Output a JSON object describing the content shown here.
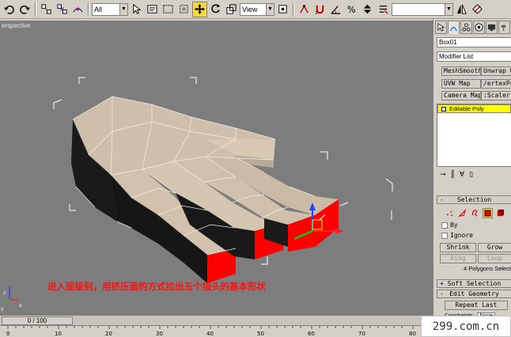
{
  "toolbar": {
    "filter_select": "All",
    "refcoord_select": "View",
    "named_sel_select": ""
  },
  "viewport": {
    "label": "erspective",
    "caption": "进入面级别，用挤压面的方式拉出五个指头的基本形状"
  },
  "timebar": {
    "slider": "0 / 100"
  },
  "ruler": {
    "ticks": [
      "0",
      "10",
      "20",
      "30",
      "40",
      "50",
      "60",
      "70",
      "80"
    ]
  },
  "panel": {
    "object_name": "Box01",
    "modifier_list": "Modifier List",
    "mod_buttons": [
      "MeshSmooth",
      "Unwrap UV",
      "UVW Map",
      "/ertexPai",
      "Camera Map",
      ":Scaler ("
    ],
    "stack_item": "Editable Poly",
    "selection": {
      "header": "Selection",
      "by": "By",
      "ignore": "Ignore",
      "shrink": "Shrink",
      "grow": "Grow",
      "ring": "Ring",
      "loop": "Loop",
      "status": "4 Polygons Selecte"
    },
    "soft_selection": "Soft Selection",
    "edit_geometry": "Edit Geometry",
    "repeat_last": "Repeat Last",
    "constraints": "Constraints:",
    "constraint_val": "None"
  },
  "watermark": "299.com.cn",
  "colors": {
    "highlight": "#f5d840",
    "stack": "#ffff00",
    "face_selected": "#ff0000"
  }
}
